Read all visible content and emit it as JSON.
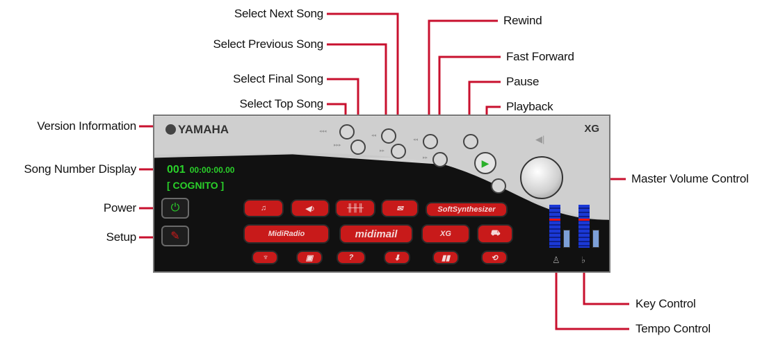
{
  "callouts": {
    "select_next_song": "Select Next Song",
    "select_previous_song": "Select Previous Song",
    "select_final_song": "Select Final Song",
    "select_top_song": "Select Top Song",
    "version_information": "Version Information",
    "song_number_display": "Song Number Display",
    "power": "Power",
    "setup": "Setup",
    "rewind": "Rewind",
    "fast_forward": "Fast Forward",
    "pause": "Pause",
    "playback": "Playback",
    "master_volume_control": "Master Volume Control",
    "key_control": "Key Control",
    "tempo_control": "Tempo Control"
  },
  "player": {
    "brand": "YAMAHA",
    "badge": "XG",
    "song_number": "001",
    "time": "00:00:00.00",
    "song_title": "[ COGNITO ]",
    "buttons": {
      "soft_synthesizer": "SoftSynthesizer",
      "midi_radio": "MidiRadio",
      "midimail": "midimail"
    }
  },
  "colors": {
    "callout_line": "#c8102e",
    "lcd_text": "#2ad12a",
    "button_red": "#c81a1a"
  }
}
